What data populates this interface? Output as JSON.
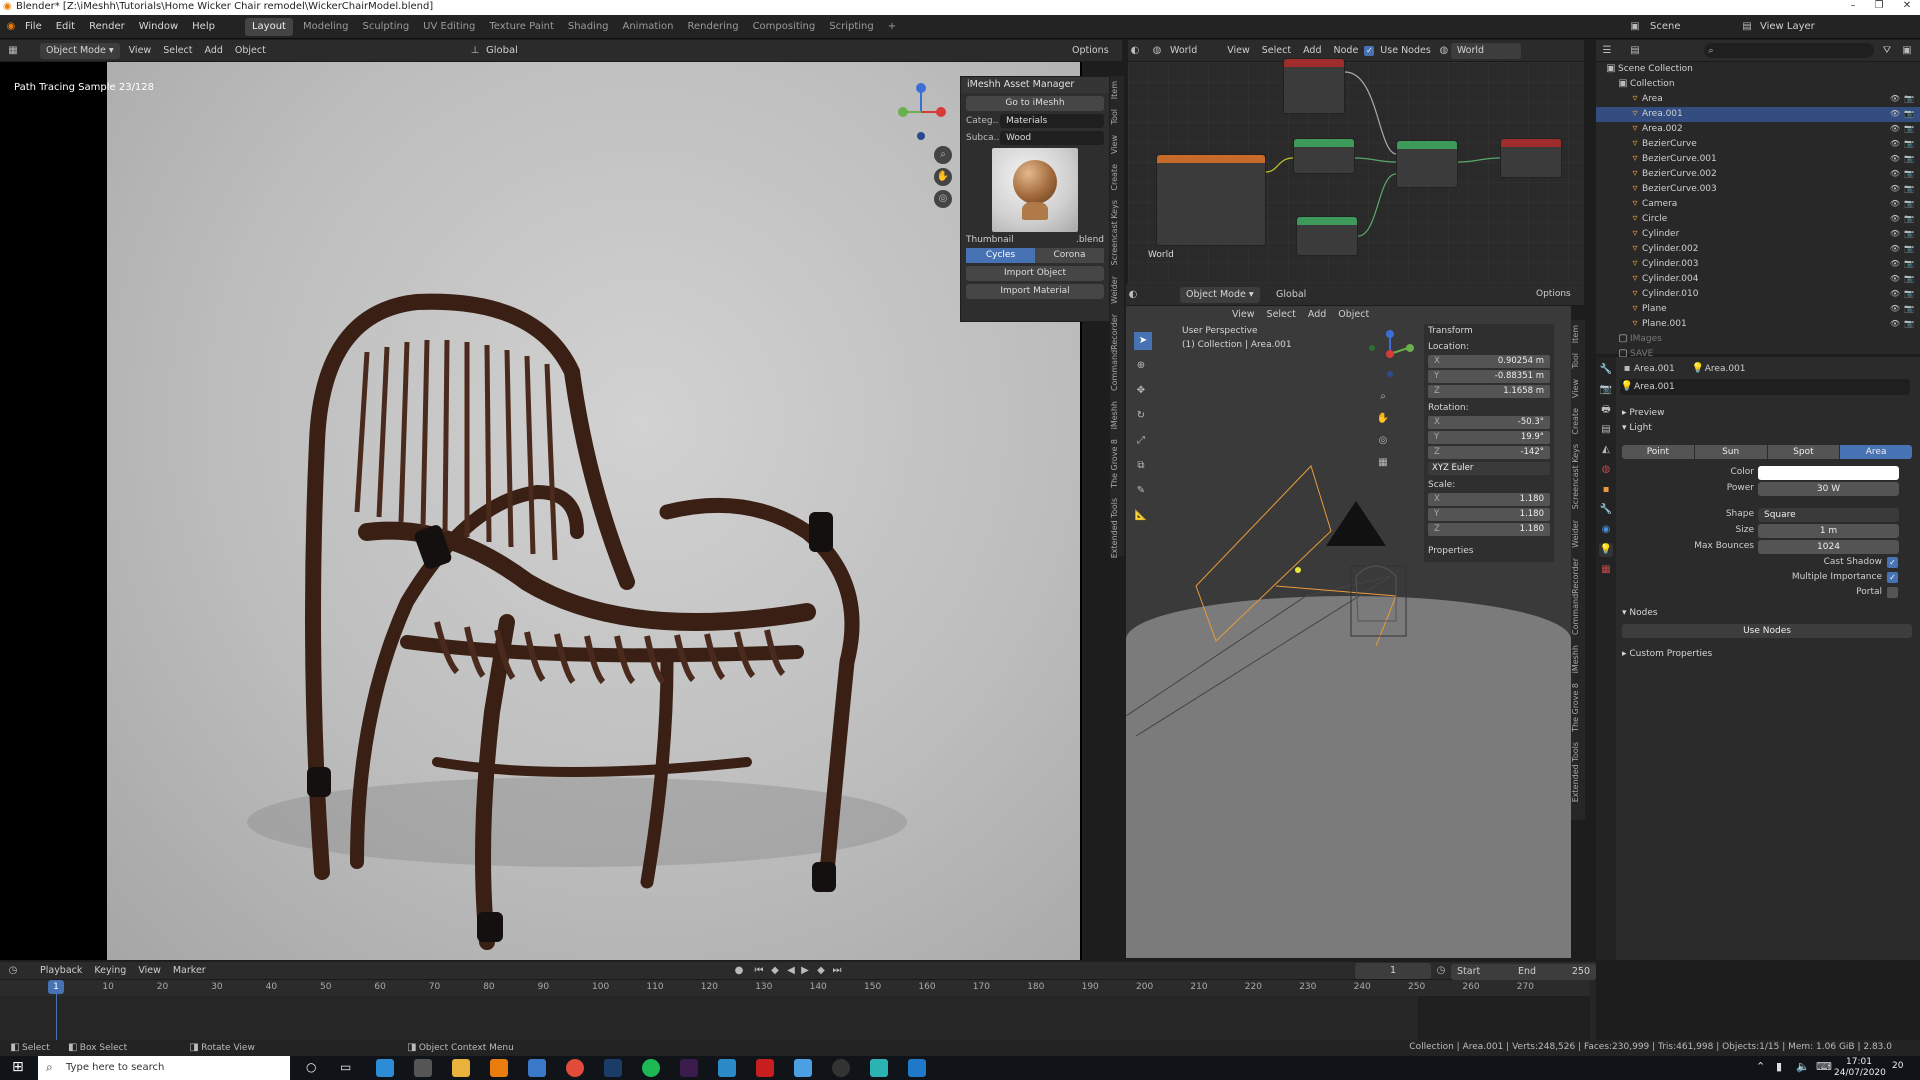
{
  "window": {
    "title": "Blender* [Z:\\iMeshh\\Tutorials\\Home Wicker Chair remodel\\WickerChairModel.blend]"
  },
  "menubar": {
    "menus": [
      "File",
      "Edit",
      "Render",
      "Window",
      "Help"
    ],
    "workspaces": [
      "Layout",
      "Modeling",
      "Sculpting",
      "UV Editing",
      "Texture Paint",
      "Shading",
      "Animation",
      "Rendering",
      "Compositing",
      "Scripting"
    ],
    "active_workspace": "Layout",
    "scene": "Scene",
    "view_layer": "View Layer"
  },
  "left_viewport": {
    "mode": "Object Mode",
    "menus": [
      "View",
      "Select",
      "Add",
      "Object"
    ],
    "orientation": "Global",
    "options": "Options",
    "overlay_text": "Path Tracing Sample 23/128"
  },
  "asset_panel": {
    "title": "iMeshh Asset Manager",
    "goto": "Go to iMeshh",
    "category_label": "Categ..",
    "category_value": "Materials",
    "subcategory_label": "Subca..",
    "subcategory_value": "Wood",
    "thumbnail_label": "Thumbnail",
    "blend_label": ".blend",
    "engines": [
      "Cycles",
      "Corona"
    ],
    "active_engine": "Cycles",
    "import_object": "Import Object",
    "import_material": "Import Material"
  },
  "sidebar_tabs": [
    "Item",
    "Tool",
    "View",
    "Create",
    "Screencast Keys",
    "Weider",
    "CommandRecorder",
    "iMeshh",
    "The Grove 8",
    "Extended Tools"
  ],
  "node_editor": {
    "world": "World",
    "menus": [
      "View",
      "Select",
      "Add",
      "Node"
    ],
    "use_nodes": "Use Nodes",
    "world_name": "World",
    "label": "World"
  },
  "right_viewport": {
    "mode": "Object Mode",
    "menus": [
      "View",
      "Select",
      "Add",
      "Object"
    ],
    "orientation": "Global",
    "options": "Options",
    "perspective": "User Perspective",
    "collection_info": "(1) Collection | Area.001",
    "transform": {
      "title": "Transform",
      "location_label": "Location:",
      "location": {
        "x": "0.90254 m",
        "y": "-0.88351 m",
        "z": "1.1658 m"
      },
      "rotation_label": "Rotation:",
      "rotation": {
        "x": "-50.3°",
        "y": "19.9°",
        "z": "-142°"
      },
      "rotation_mode": "XYZ Euler",
      "scale_label": "Scale:",
      "scale": {
        "x": "1.180",
        "y": "1.180",
        "z": "1.180"
      },
      "axis_x": "X",
      "axis_y": "Y",
      "axis_z": "Z"
    },
    "properties": "Properties"
  },
  "outliner": {
    "root": "Scene Collection",
    "collection": "Collection",
    "items": [
      "Area",
      "Area.001",
      "Area.002",
      "BezierCurve",
      "BezierCurve.001",
      "BezierCurve.002",
      "BezierCurve.003",
      "Camera",
      "Circle",
      "Cylinder",
      "Cylinder.002",
      "Cylinder.003",
      "Cylinder.004",
      "Cylinder.010",
      "Plane",
      "Plane.001"
    ],
    "selected": "Area.001",
    "extra": [
      "IMages",
      "SAVE"
    ]
  },
  "properties": {
    "object": "Area.001",
    "data": "Area.001",
    "datablock": "Area.001",
    "preview": "Preview",
    "light": "Light",
    "light_types": [
      "Point",
      "Sun",
      "Spot",
      "Area"
    ],
    "active_type": "Area",
    "color_label": "Color",
    "color": "#ffffff",
    "power_label": "Power",
    "power": "30 W",
    "shape_label": "Shape",
    "shape": "Square",
    "size_label": "Size",
    "size": "1 m",
    "max_bounces_label": "Max Bounces",
    "max_bounces": "1024",
    "cast_shadow": "Cast Shadow",
    "multiple_importance": "Multiple Importance",
    "portal": "Portal",
    "nodes": "Nodes",
    "use_nodes": "Use Nodes",
    "custom_properties": "Custom Properties"
  },
  "timeline": {
    "menus": [
      "Playback",
      "Keying",
      "View",
      "Marker"
    ],
    "current_frame": "1",
    "start_label": "Start",
    "start": "1",
    "end_label": "End",
    "end": "250",
    "ticks": [
      "10",
      "20",
      "30",
      "40",
      "50",
      "60",
      "70",
      "80",
      "90",
      "100",
      "110",
      "120",
      "130",
      "140",
      "150",
      "160",
      "170",
      "180",
      "190",
      "200",
      "210",
      "220",
      "230",
      "240",
      "250",
      "260",
      "270"
    ],
    "playhead": "1"
  },
  "statusbar": {
    "select": "Select",
    "box_select": "Box Select",
    "rotate_view": "Rotate View",
    "context_menu": "Object Context Menu",
    "stats": "Collection | Area.001 | Verts:248,526 | Faces:230,999 | Tris:461,998 | Objects:1/15 | Mem: 1.06 GiB | 2.83.0"
  },
  "taskbar": {
    "search_placeholder": "Type here to search",
    "time": "17:01",
    "date": "24/07/2020",
    "notifications": "20"
  }
}
